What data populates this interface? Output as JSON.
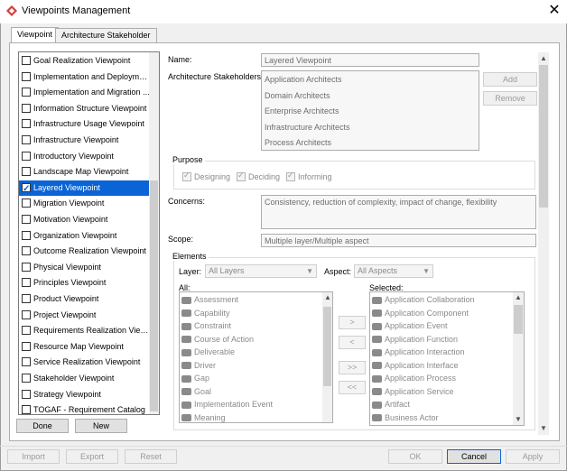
{
  "window": {
    "title": "Viewpoints Management",
    "close_glyph": "✕"
  },
  "tabs": [
    {
      "label": "Viewpoint",
      "active": true
    },
    {
      "label": "Architecture Stakeholder",
      "active": false
    }
  ],
  "viewpoints": [
    {
      "label": "Goal Realization Viewpoint",
      "checked": false
    },
    {
      "label": "Implementation and Deployme...",
      "checked": false
    },
    {
      "label": "Implementation and Migration ...",
      "checked": false
    },
    {
      "label": "Information Structure Viewpoint",
      "checked": false
    },
    {
      "label": "Infrastructure Usage Viewpoint",
      "checked": false
    },
    {
      "label": "Infrastructure Viewpoint",
      "checked": false
    },
    {
      "label": "Introductory Viewpoint",
      "checked": false
    },
    {
      "label": "Landscape Map Viewpoint",
      "checked": false
    },
    {
      "label": "Layered Viewpoint",
      "checked": true
    },
    {
      "label": "Migration Viewpoint",
      "checked": false
    },
    {
      "label": "Motivation Viewpoint",
      "checked": false
    },
    {
      "label": "Organization Viewpoint",
      "checked": false
    },
    {
      "label": "Outcome Realization Viewpoint",
      "checked": false
    },
    {
      "label": "Physical Viewpoint",
      "checked": false
    },
    {
      "label": "Principles Viewpoint",
      "checked": false
    },
    {
      "label": "Product Viewpoint",
      "checked": false
    },
    {
      "label": "Project Viewpoint",
      "checked": false
    },
    {
      "label": "Requirements Realization View...",
      "checked": false
    },
    {
      "label": "Resource Map Viewpoint",
      "checked": false
    },
    {
      "label": "Service Realization Viewpoint",
      "checked": false
    },
    {
      "label": "Stakeholder Viewpoint",
      "checked": false
    },
    {
      "label": "Strategy Viewpoint",
      "checked": false
    },
    {
      "label": "TOGAF - Requirement Catalog",
      "checked": false
    }
  ],
  "left_buttons": {
    "done": "Done",
    "new": "New"
  },
  "form": {
    "name_label": "Name:",
    "name_value": "Layered Viewpoint",
    "stakeholders_label": "Architecture Stakeholders:",
    "stakeholders": [
      "Application Architects",
      "Domain Architects",
      "Enterprise Architects",
      "Infrastructure Architects",
      "Process Architects"
    ],
    "add_label": "Add",
    "remove_label": "Remove",
    "purpose_title": "Purpose",
    "purpose": [
      {
        "label": "Designing",
        "checked": true
      },
      {
        "label": "Deciding",
        "checked": true
      },
      {
        "label": "Informing",
        "checked": true
      }
    ],
    "concerns_label": "Concerns:",
    "concerns_value": "Consistency, reduction of complexity, impact of change, flexibility",
    "scope_label": "Scope:",
    "scope_value": "Multiple layer/Multiple aspect",
    "elements_title": "Elements",
    "layer_label": "Layer:",
    "layer_value": "All Layers",
    "aspect_label": "Aspect:",
    "aspect_value": "All Aspects",
    "all_label": "All:",
    "selected_label": "Selected:",
    "all_items": [
      "Assessment",
      "Capability",
      "Constraint",
      "Course of Action",
      "Deliverable",
      "Driver",
      "Gap",
      "Goal",
      "Implementation Event",
      "Meaning"
    ],
    "selected_items": [
      "Application Collaboration",
      "Application Component",
      "Application Event",
      "Application Function",
      "Application Interaction",
      "Application Interface",
      "Application Process",
      "Application Service",
      "Artifact",
      "Business Actor"
    ],
    "move_buttons": [
      ">",
      "<",
      ">>",
      "<<"
    ]
  },
  "bottom_buttons": {
    "import": "Import",
    "export": "Export",
    "reset": "Reset",
    "ok": "OK",
    "cancel": "Cancel",
    "apply": "Apply"
  },
  "colors": {
    "selection": "#0a64d6",
    "brand_icon": "#d63a3a"
  }
}
